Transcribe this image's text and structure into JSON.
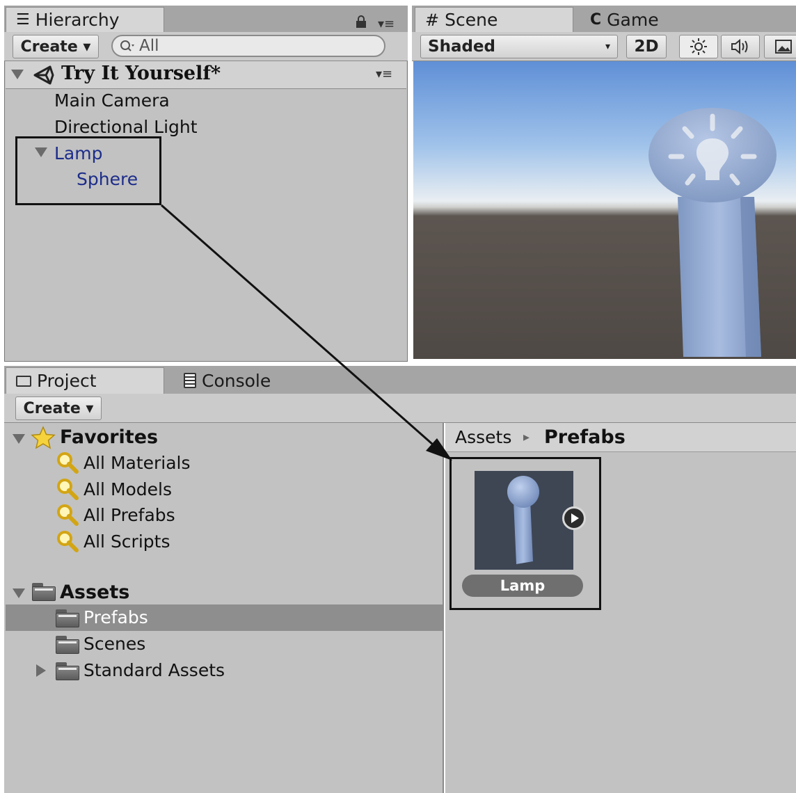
{
  "hierarchy": {
    "tab_label": "Hierarchy",
    "create_label": "Create ▾",
    "search_placeholder": "All",
    "scene_name": "Try It Yourself*",
    "items": [
      {
        "label": "Main Camera"
      },
      {
        "label": "Directional Light"
      },
      {
        "label": "Lamp"
      },
      {
        "label": "Sphere"
      }
    ]
  },
  "scene": {
    "tab_label": "Scene",
    "game_tab_label": "Game",
    "shading_mode": "Shaded",
    "btn_2d": "2D",
    "icons": [
      "sun-icon",
      "speaker-icon",
      "image-icon"
    ]
  },
  "project": {
    "tab_label": "Project",
    "console_tab_label": "Console",
    "create_label": "Create ▾",
    "favorites_label": "Favorites",
    "favorites": [
      {
        "label": "All Materials"
      },
      {
        "label": "All Models"
      },
      {
        "label": "All Prefabs"
      },
      {
        "label": "All Scripts"
      }
    ],
    "assets_label": "Assets",
    "folders": [
      {
        "label": "Prefabs",
        "selected": true
      },
      {
        "label": "Scenes"
      },
      {
        "label": "Standard Assets"
      }
    ],
    "breadcrumb": {
      "root": "Assets",
      "separator": "▸",
      "current": "Prefabs"
    },
    "prefab_label": "Lamp"
  },
  "colors": {
    "panel": "#c2c2c2",
    "selected_row": "#8e8e8e",
    "hierarchy_child": "#1d2d8a",
    "lamp_blue": "#8aa7d6"
  }
}
